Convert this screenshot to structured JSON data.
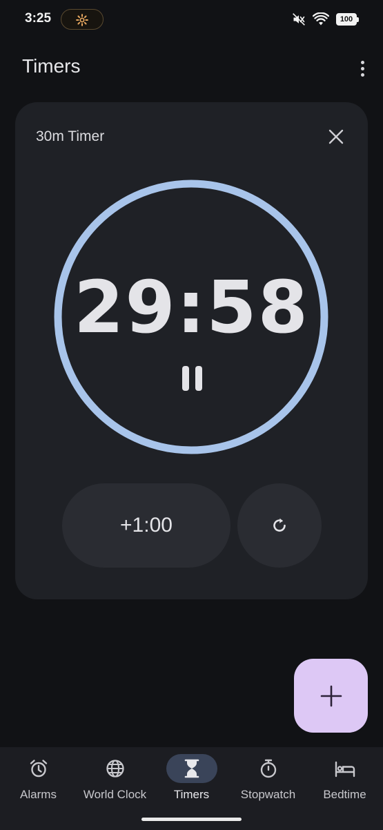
{
  "status_bar": {
    "time": "3:25",
    "battery": "100",
    "icons": [
      "gear-icon",
      "mute-icon",
      "wifi-icon",
      "battery-icon"
    ]
  },
  "app_bar": {
    "title": "Timers",
    "menu_icon": "more-vert-icon"
  },
  "timer": {
    "label": "30m Timer",
    "remaining": "29:58",
    "progress_fraction": 0.999,
    "add_label": "+1:00",
    "pause_icon": "pause-icon",
    "reset_icon": "reset-icon",
    "close_icon": "close-icon"
  },
  "fab": {
    "icon": "plus-icon"
  },
  "bottom_nav": {
    "items": [
      {
        "label": "Alarms",
        "icon": "alarm-icon"
      },
      {
        "label": "World Clock",
        "icon": "globe-icon"
      },
      {
        "label": "Timers",
        "icon": "hourglass-icon",
        "active": true
      },
      {
        "label": "Stopwatch",
        "icon": "stopwatch-icon"
      },
      {
        "label": "Bedtime",
        "icon": "bed-icon"
      }
    ]
  },
  "colors": {
    "background": "#111215",
    "card": "#1f2126",
    "ring": "#a8c4ea",
    "fab": "#ddc8f5",
    "nav_active": "#3a4459"
  }
}
